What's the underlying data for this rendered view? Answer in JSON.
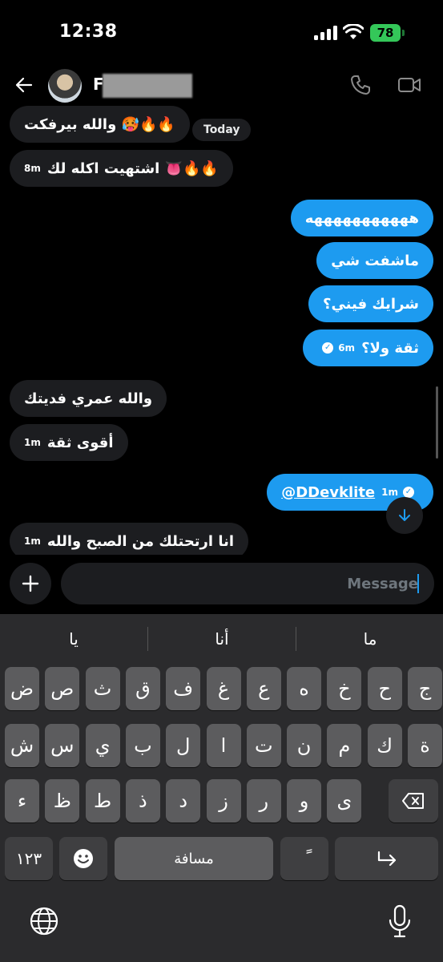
{
  "status_bar": {
    "time": "12:38",
    "battery": "78"
  },
  "header": {
    "name_initial": "F"
  },
  "chat": {
    "today_label": "Today",
    "messages": [
      {
        "dir": "in",
        "text": "والله بيرفكت 🥵🔥🔥",
        "time": ""
      },
      {
        "dir": "in",
        "text": "اشتهيت اكله لك 👅🔥🔥",
        "time": "8m"
      },
      {
        "dir": "out",
        "text": "هههههههههههه",
        "time": ""
      },
      {
        "dir": "out",
        "text": "ماشفت شي",
        "time": ""
      },
      {
        "dir": "out",
        "text": "شرايك فيني؟",
        "time": ""
      },
      {
        "dir": "out",
        "text": "ثقة ولا؟",
        "time": "6m"
      },
      {
        "dir": "in",
        "text": "والله عمري فديتك",
        "time": ""
      },
      {
        "dir": "in",
        "text": "أقوى ثقة",
        "time": "1m"
      },
      {
        "dir": "out",
        "text": "@DDevklite",
        "time": "1m"
      },
      {
        "dir": "in",
        "text": "انا ارتحتلك من الصبح والله",
        "time": "1m"
      }
    ]
  },
  "compose": {
    "placeholder": "Message"
  },
  "keyboard": {
    "suggestions": [
      "يا",
      "أنا",
      "ما"
    ],
    "row1": [
      "ض",
      "ص",
      "ث",
      "ق",
      "ف",
      "غ",
      "ع",
      "ه",
      "خ",
      "ح",
      "ج"
    ],
    "row2": [
      "ش",
      "س",
      "ي",
      "ب",
      "ل",
      "ا",
      "ت",
      "ن",
      "م",
      "ك",
      "ة"
    ],
    "row3": [
      "ء",
      "ظ",
      "ط",
      "ذ",
      "د",
      "ز",
      "ر",
      "و",
      "ى"
    ],
    "numbers_label": "١٢٣",
    "space_label": "مسافة",
    "diacritic_label": "ً"
  }
}
